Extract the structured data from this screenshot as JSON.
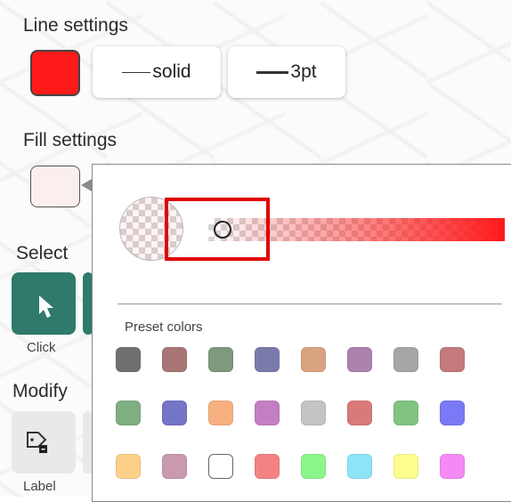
{
  "line_settings": {
    "title": "Line settings",
    "color": "#ff1a1a",
    "style_label": "solid",
    "width_label": "3pt"
  },
  "fill_settings": {
    "title": "Fill settings",
    "color": "#fbeeee"
  },
  "select_section": {
    "title": "Select",
    "tool_label": "Click",
    "active_color": "#2f7a6a"
  },
  "modify_section": {
    "title": "Modify",
    "tool_label": "Label"
  },
  "color_picker": {
    "base_color": "#ff1a1a",
    "opacity": 0.05,
    "preset_title": "Preset colors",
    "presets": [
      "#707070",
      "#a97676",
      "#7d9a7f",
      "#7a7bab",
      "#d9a382",
      "#ad82ad",
      "#a6a6a6",
      "#c47a7a",
      "#7fae82",
      "#7575c8",
      "#f8b080",
      "#c47fc4",
      "#c4c4c4",
      "#d97a7a",
      "#80c480",
      "#7a7af7",
      "#fdd08a",
      "#c99aae",
      "#ffffff",
      "#f58282",
      "#8cf58c",
      "#8ce4f7",
      "#fdfd8c",
      "#f58af5"
    ]
  }
}
